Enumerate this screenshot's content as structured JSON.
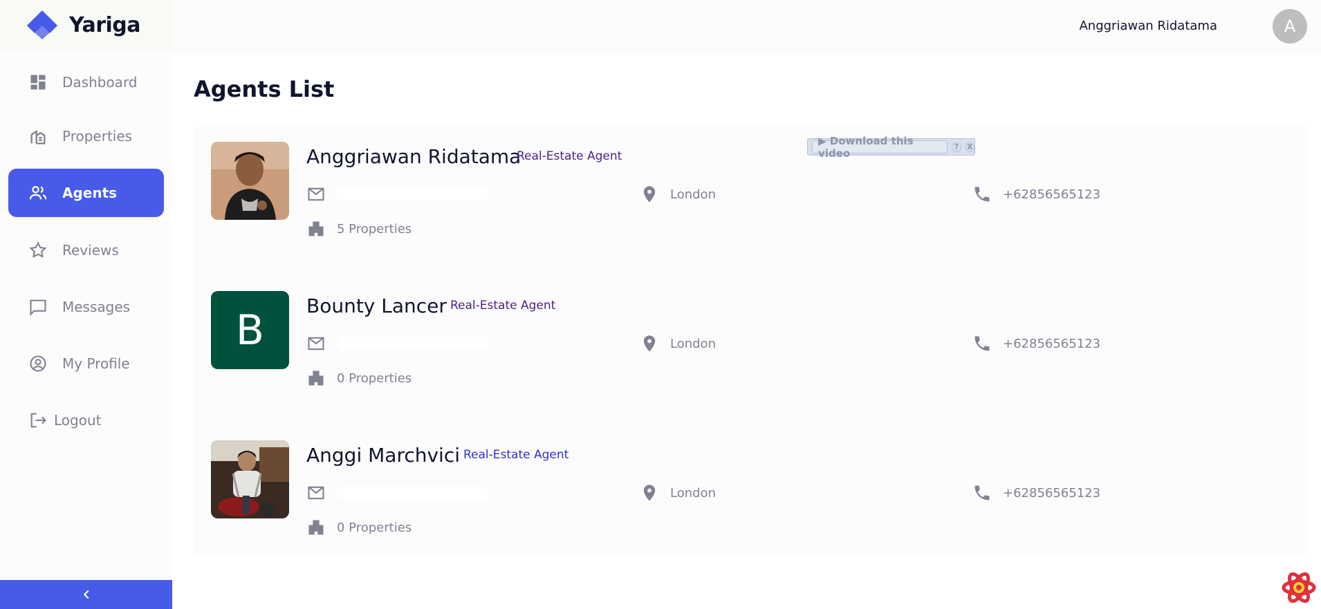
{
  "app": {
    "name": "Yariga"
  },
  "sidebar": {
    "items": [
      {
        "label": "Dashboard",
        "icon": "dashboard-icon",
        "active": false
      },
      {
        "label": "Properties",
        "icon": "properties-icon",
        "active": false
      },
      {
        "label": "Agents",
        "icon": "agents-icon",
        "active": true
      },
      {
        "label": "Reviews",
        "icon": "star-icon",
        "active": false
      },
      {
        "label": "Messages",
        "icon": "chat-icon",
        "active": false
      },
      {
        "label": "My Profile",
        "icon": "profile-icon",
        "active": false
      },
      {
        "label": "Logout",
        "icon": "logout-icon",
        "active": false
      }
    ],
    "collapse_icon": "chevron-left-icon"
  },
  "header": {
    "user_name": "Anggriawan Ridatama",
    "avatar_letter": "A"
  },
  "main": {
    "title": "Agents List",
    "agents": [
      {
        "name": "Anggriawan Ridatama",
        "role": "Real-Estate Agent",
        "location": "London",
        "phone": "+62856565123",
        "properties": "5 Properties",
        "avatar": "photo"
      },
      {
        "name": "Bounty Lancer",
        "role": "Real-Estate Agent",
        "location": "London",
        "phone": "+62856565123",
        "properties": "0 Properties",
        "avatar_letter": "B"
      },
      {
        "name": "Anggi Marchvici",
        "role": "Real-Estate Agent",
        "location": "London",
        "phone": "+62856565123",
        "properties": "0 Properties",
        "avatar": "photo"
      }
    ]
  },
  "overlay": {
    "download_label": "▶ Download this video",
    "help": "?",
    "close": "X"
  },
  "colors": {
    "accent": "#475be8",
    "text_dark": "#11142d",
    "text_muted": "#808191",
    "role_purple": "#4b1f80",
    "role_blue": "#2f2fd1",
    "avatar_green": "#00513d"
  }
}
